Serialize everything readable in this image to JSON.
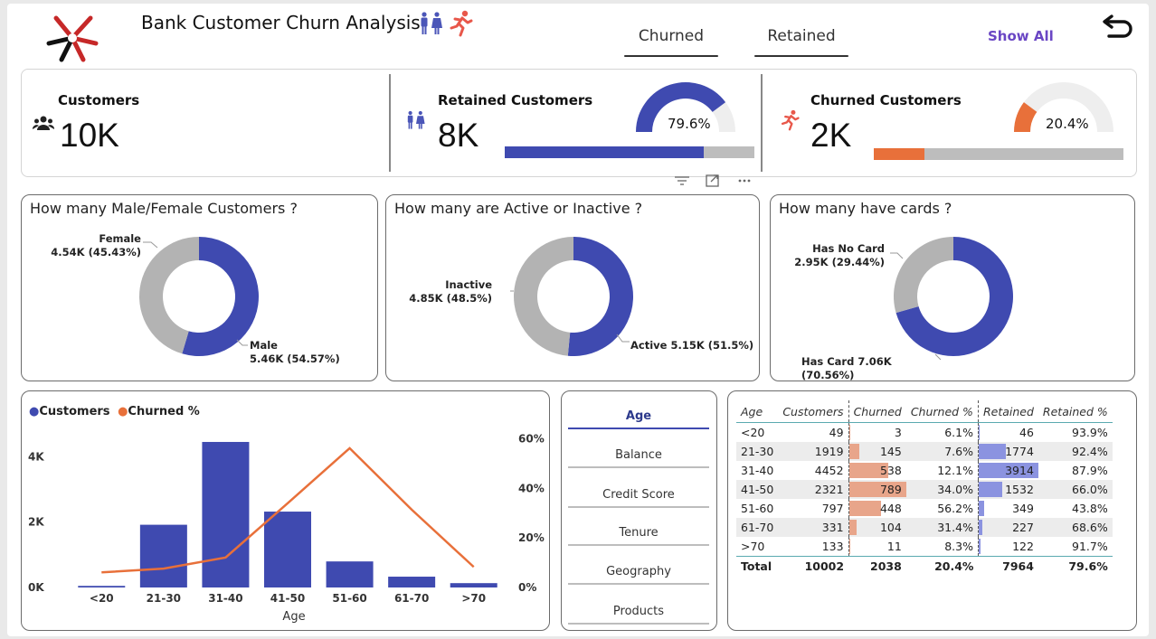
{
  "header": {
    "title": "Bank Customer Churn Analysis",
    "tabs": [
      {
        "label": "Churned"
      },
      {
        "label": "Retained"
      }
    ],
    "show_all": "Show All"
  },
  "kpis": {
    "customers": {
      "label": "Customers",
      "value": "10K"
    },
    "retained": {
      "label": "Retained Customers",
      "value": "8K",
      "pct_label": "79.6%",
      "pct": 0.796,
      "color": "#3F4AB0"
    },
    "churned": {
      "label": "Churned Customers",
      "value": "2K",
      "pct_label": "20.4%",
      "pct": 0.204,
      "color": "#E8703A"
    }
  },
  "donuts": {
    "gender": {
      "title": "How many Male/Female Customers ?",
      "slices": [
        {
          "name": "Male",
          "value_label": "5.46K (54.57%)",
          "pct": 54.57,
          "color": "#3F4AB0"
        },
        {
          "name": "Female",
          "value_label": "4.54K (45.43%)",
          "pct": 45.43,
          "color": "#B3B3B3"
        }
      ]
    },
    "active": {
      "title": "How many are Active or Inactive ?",
      "slices": [
        {
          "name": "Active",
          "value_label": "5.15K (51.5%)",
          "pct": 51.5,
          "color": "#3F4AB0"
        },
        {
          "name": "Inactive",
          "value_label": "4.85K (48.5%)",
          "pct": 48.5,
          "color": "#B3B3B3"
        }
      ]
    },
    "cards": {
      "title": "How many have cards ?",
      "slices": [
        {
          "name": "Has Card",
          "value_label": "7.06K (70.56%)",
          "pct": 70.56,
          "color": "#3F4AB0"
        },
        {
          "name": "Has No Card",
          "value_label": "2.95K (29.44%)",
          "pct": 29.44,
          "color": "#B3B3B3"
        }
      ]
    }
  },
  "chart_data": {
    "type": "bar",
    "categories": [
      "<20",
      "21-30",
      "31-40",
      "41-50",
      "51-60",
      "61-70",
      ">70"
    ],
    "xlabel": "Age",
    "series": [
      {
        "name": "Customers",
        "type": "bar",
        "axis": "left",
        "color": "#3F4AB0",
        "values": [
          49,
          1919,
          4452,
          2321,
          797,
          331,
          133
        ]
      },
      {
        "name": "Churned %",
        "type": "line",
        "axis": "right",
        "color": "#E8703A",
        "values": [
          6.1,
          7.6,
          12.1,
          34.0,
          56.2,
          31.4,
          8.3
        ]
      }
    ],
    "y_left": {
      "ticks": [
        "0K",
        "2K",
        "4K"
      ],
      "max": 4700
    },
    "y_right": {
      "ticks": [
        "0%",
        "20%",
        "40%",
        "60%"
      ],
      "max": 62
    }
  },
  "slicer": {
    "items": [
      {
        "label": "Age",
        "selected": true
      },
      {
        "label": "Balance"
      },
      {
        "label": "Credit Score"
      },
      {
        "label": "Tenure"
      },
      {
        "label": "Geography"
      },
      {
        "label": "Products"
      }
    ]
  },
  "table": {
    "columns": [
      "Age",
      "Customers",
      "Churned",
      "Churned %",
      "Retained",
      "Retained %"
    ],
    "rows": [
      [
        "<20",
        "49",
        "3",
        "6.1%",
        "46",
        "93.9%"
      ],
      [
        "21-30",
        "1919",
        "145",
        "7.6%",
        "1774",
        "92.4%"
      ],
      [
        "31-40",
        "4452",
        "538",
        "12.1%",
        "3914",
        "87.9%"
      ],
      [
        "41-50",
        "2321",
        "789",
        "34.0%",
        "1532",
        "66.0%"
      ],
      [
        "51-60",
        "797",
        "448",
        "56.2%",
        "349",
        "43.8%"
      ],
      [
        "61-70",
        "331",
        "104",
        "31.4%",
        "227",
        "68.6%"
      ],
      [
        ">70",
        "133",
        "11",
        "8.3%",
        "122",
        "91.7%"
      ]
    ],
    "total": [
      "Total",
      "10002",
      "2038",
      "20.4%",
      "7964",
      "79.6%"
    ],
    "churned_bar_color": "#E8A58A",
    "retained_bar_color": "#8B93E0"
  }
}
